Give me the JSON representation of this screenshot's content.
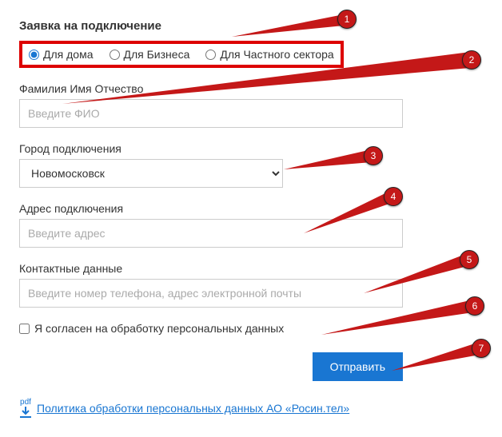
{
  "form": {
    "title": "Заявка на подключение",
    "radios": {
      "home": "Для дома",
      "business": "Для Бизнеса",
      "private_sector": "Для Частного сектора"
    },
    "fullname": {
      "label": "Фамилия Имя Отчество",
      "placeholder": "Введите ФИО"
    },
    "city": {
      "label": "Город подключения",
      "selected": "Новомосковск"
    },
    "address": {
      "label": "Адрес подключения",
      "placeholder": "Введите адрес"
    },
    "contact": {
      "label": "Контактные данные",
      "placeholder": "Введите номер телефона, адрес электронной почты"
    },
    "consent_label": "Я согласен на обработку персональных данных",
    "submit_label": "Отправить",
    "policy": {
      "pdf_tag": "pdf",
      "link_text": "Политика обработки персональных данных АО «Росин.тел»"
    }
  },
  "callouts": {
    "c1": "1",
    "c2": "2",
    "c3": "3",
    "c4": "4",
    "c5": "5",
    "c6": "6",
    "c7": "7"
  },
  "colors": {
    "accent_red": "#c41818",
    "highlight_border": "#d00",
    "primary_blue": "#1976d2"
  }
}
